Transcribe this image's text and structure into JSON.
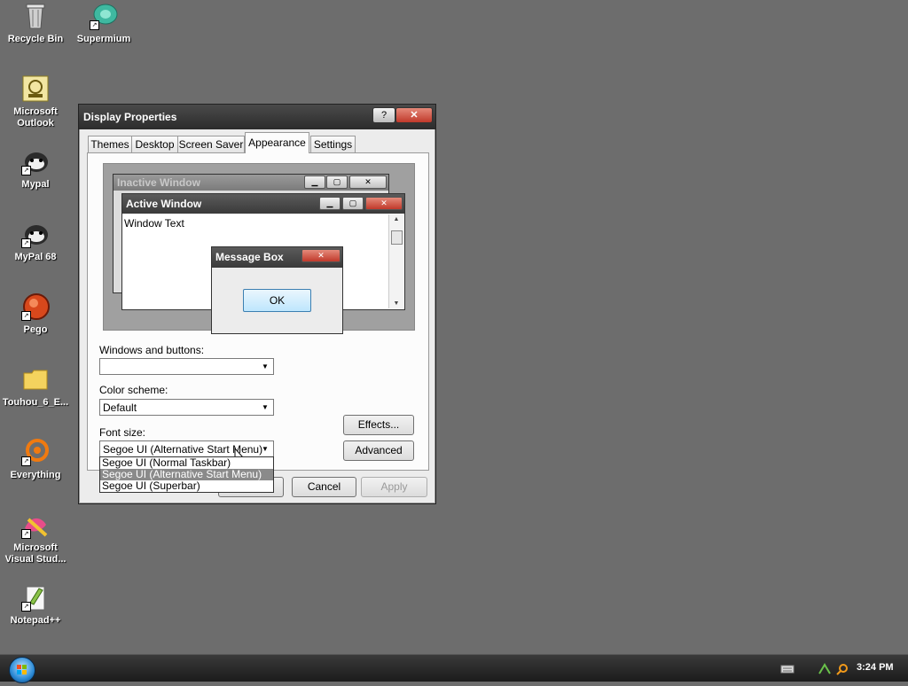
{
  "desktop": {
    "icons": [
      {
        "label": "Recycle Bin"
      },
      {
        "label": "Supermium"
      },
      {
        "label": "Microsoft Outlook"
      },
      {
        "label": "Mypal"
      },
      {
        "label": "MyPal 68"
      },
      {
        "label": "Pego"
      },
      {
        "label": "Touhou_6_E..."
      },
      {
        "label": "Everything"
      },
      {
        "label": "Microsoft Visual Stud..."
      },
      {
        "label": "Notepad++"
      }
    ]
  },
  "dialog": {
    "title": "Display Properties",
    "help_label": "?",
    "close_label": "✕",
    "tabs": [
      {
        "label": "Themes"
      },
      {
        "label": "Desktop"
      },
      {
        "label": "Screen Saver"
      },
      {
        "label": "Appearance"
      },
      {
        "label": "Settings"
      }
    ],
    "active_tab": "Appearance",
    "preview": {
      "inactive_title": "Inactive Window",
      "active_title": "Active Window",
      "window_text": "Window Text",
      "message_box_title": "Message Box",
      "ok_label": "OK"
    },
    "windows_buttons": {
      "label": "Windows and buttons:",
      "value": ""
    },
    "color_scheme": {
      "label": "Color scheme:",
      "value": "Default"
    },
    "font_size": {
      "label": "Font size:",
      "value": "Segoe UI (Alternative Start Menu)",
      "options": [
        "Segoe UI (Normal Taskbar)",
        "Segoe UI (Alternative Start Menu)",
        "Segoe UI (Superbar)"
      ],
      "selected_index": 1
    },
    "effects_label": "Effects...",
    "advanced_label": "Advanced",
    "cancel_label": "Cancel",
    "apply_label": "Apply"
  },
  "taskbar": {
    "clock": "3:24 PM"
  }
}
